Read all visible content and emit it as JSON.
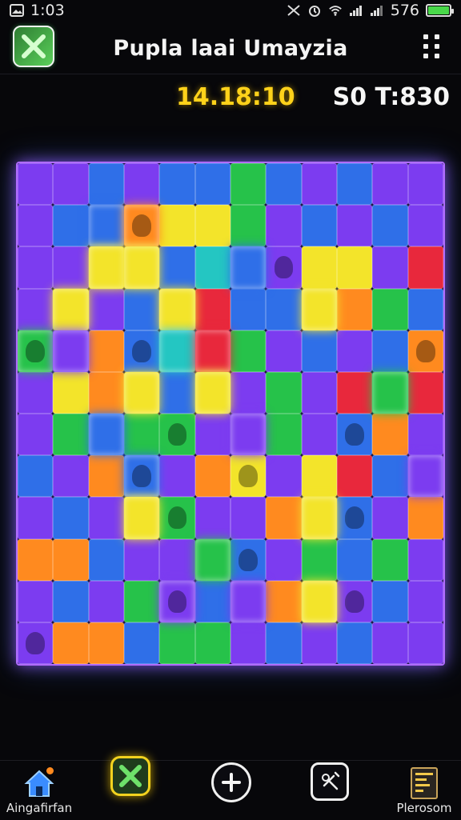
{
  "status_bar": {
    "time": "1:03",
    "battery_text": "576"
  },
  "header": {
    "title": "Pupla laai Umayzia"
  },
  "timer": {
    "value": "14.18:10"
  },
  "score": {
    "value": "S0 T:830"
  },
  "board": {
    "columns": 12,
    "rows": 12,
    "tiles": [
      "P",
      "P",
      "B",
      "P",
      "B",
      "B",
      "G",
      "B",
      "P",
      "B",
      "P",
      "P",
      "P",
      "B",
      "B",
      "O",
      "Y",
      "Y",
      "G",
      "P",
      "B",
      "P",
      "B",
      "P",
      "P",
      "P",
      "Y",
      "Y",
      "B",
      "C",
      "B",
      "P",
      "Y",
      "Y",
      "P",
      "R",
      "P",
      "Y",
      "P",
      "B",
      "Y",
      "R",
      "B",
      "B",
      "Y",
      "O",
      "G",
      "B",
      "G",
      "P",
      "O",
      "B",
      "C",
      "R",
      "G",
      "P",
      "B",
      "P",
      "B",
      "O",
      "P",
      "Y",
      "O",
      "Y",
      "B",
      "Y",
      "P",
      "G",
      "P",
      "R",
      "G",
      "R",
      "P",
      "G",
      "B",
      "G",
      "G",
      "P",
      "P",
      "G",
      "P",
      "B",
      "O",
      "P",
      "B",
      "P",
      "O",
      "B",
      "P",
      "O",
      "Y",
      "P",
      "Y",
      "R",
      "B",
      "P",
      "P",
      "B",
      "P",
      "Y",
      "G",
      "P",
      "P",
      "O",
      "Y",
      "B",
      "P",
      "O",
      "O",
      "O",
      "B",
      "P",
      "P",
      "G",
      "B",
      "P",
      "G",
      "B",
      "G",
      "P",
      "P",
      "B",
      "P",
      "G",
      "P",
      "B",
      "P",
      "O",
      "Y",
      "P",
      "B",
      "P",
      "P",
      "O",
      "O",
      "B",
      "G",
      "G",
      "P",
      "B",
      "P",
      "B",
      "P",
      "P"
    ],
    "glow_tiles": [
      14,
      15,
      26,
      27,
      30,
      37,
      40,
      44,
      48,
      49,
      52,
      53,
      63,
      65,
      70,
      74,
      78,
      87,
      95,
      99,
      104,
      113,
      124,
      126,
      128
    ],
    "creature_tiles": [
      15,
      31,
      48,
      51,
      59,
      76,
      81,
      87,
      90,
      100,
      105,
      114,
      124,
      129,
      132
    ],
    "colors": {
      "P": "#7c3cf0",
      "B": "#2f6fe8",
      "G": "#26c24a",
      "Y": "#f3e42a",
      "O": "#ff8a1f",
      "R": "#e8283c",
      "C": "#24c6c2"
    },
    "border_color": "#b06cff"
  },
  "bottom_nav": {
    "home_label": "Aingafirfan",
    "profile_label": "Plerosom",
    "items": [
      {
        "name": "home",
        "icon": "home-icon"
      },
      {
        "name": "puzzle",
        "icon": "puzzle-x-icon"
      },
      {
        "name": "add",
        "icon": "plus-circle-icon"
      },
      {
        "name": "tools",
        "icon": "tools-icon"
      },
      {
        "name": "calendar",
        "icon": "calendar-icon"
      }
    ]
  },
  "accent_colors": {
    "timer": "#ffd21a",
    "glow": "#b06cff",
    "app_icon": "#5ad05a"
  }
}
